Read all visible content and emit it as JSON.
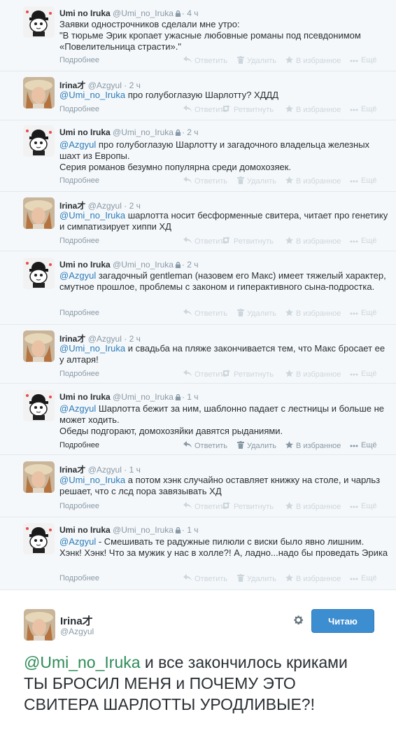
{
  "actions": {
    "details": "Подробнее",
    "reply": "Ответить",
    "retweet": "Ретвитнуть",
    "delete": "Удалить",
    "favorite": "В избранное",
    "more": "Ещё"
  },
  "tweets": [
    {
      "name": "Umi no Iruka",
      "handle": "@Umi_no_Iruka",
      "time": "· 4 ч",
      "mention": "",
      "text": "Заявки однострочников сделали мне утро:\n\"В тюрьме Эрик кропает ужасные любовные романы под псевдонимом «Повелительница страсти».\""
    },
    {
      "name": "Irina才",
      "handle": "@Azgyul",
      "time": "· 2 ч",
      "mention": "@Umi_no_Iruka",
      "text": " про голубоглазую Шарлотту? ХДДД"
    },
    {
      "name": "Umi no Iruka",
      "handle": "@Umi_no_Iruka",
      "time": "· 2 ч",
      "mention": "@Azgyul",
      "text": " про голубоглазую Шарлотту и загадочного владельца железных шахт из Европы.\nСерия романов безумно популярна среди домохозяек."
    },
    {
      "name": "Irina才",
      "handle": "@Azgyul",
      "time": "· 2 ч",
      "mention": "@Umi_no_Iruka",
      "text": " шарлотта носит бесформенные свитера, читает про генетику и симпатизирует хиппи ХД"
    },
    {
      "name": "Umi no Iruka",
      "handle": "@Umi_no_Iruka",
      "time": "· 2 ч",
      "mention": "@Azgyul",
      "text": " загадочный gentleman (назовем его Макс) имеет тяжелый характер, смутное прошлое, проблемы с законом и гиперактивного сына-подростка."
    },
    {
      "name": "Irina才",
      "handle": "@Azgyul",
      "time": "· 2 ч",
      "mention": "@Umi_no_Iruka",
      "text": " и свадьба на пляже закончивается тем, что Макс бросает ее у алтаря!"
    },
    {
      "name": "Umi no Iruka",
      "handle": "@Umi_no_Iruka",
      "time": "· 1 ч",
      "mention": "@Azgyul",
      "text": " Шарлотта бежит за ним, шаблонно падает с лестницы и больше не может ходить.\nОбеды подгорают, домохозяйки давятся рыданиями."
    },
    {
      "name": "Irina才",
      "handle": "@Azgyul",
      "time": "· 1 ч",
      "mention": "@Umi_no_Iruka",
      "text": " а потом хэнк случайно оставляет книжку на столе, и чарльз решает, что с лсд пора завязывать ХД"
    },
    {
      "name": "Umi no Iruka",
      "handle": "@Umi_no_Iruka",
      "time": "· 1 ч",
      "mention": "@Azgyul",
      "text": " - Смешивать те радужные пилюли с виски было явно лишним. Хэнк! Хэнк! Что за мужик у нас в холле?! А, ладно...надо бы проведать Эрика"
    }
  ],
  "main_tweet": {
    "name": "Irina才",
    "handle": "@Azgyul",
    "follow_label": "Читаю",
    "mention": "@Umi_no_Iruka",
    "text": " и все закончилось криками ТЫ БРОСИЛ МЕНЯ и ПОЧЕМУ ЭТО СВИТЕРА ШАРЛОТТЫ УРОДЛИВЫЕ?!"
  },
  "colors": {
    "link": "#2b7bb9",
    "main_mention": "#2e8b57",
    "button": "#3d8ed0",
    "muted": "#8899a6"
  },
  "icons": [
    "lock-icon",
    "reply-icon",
    "retweet-icon",
    "trash-icon",
    "star-icon",
    "more-icon",
    "gear-icon"
  ]
}
